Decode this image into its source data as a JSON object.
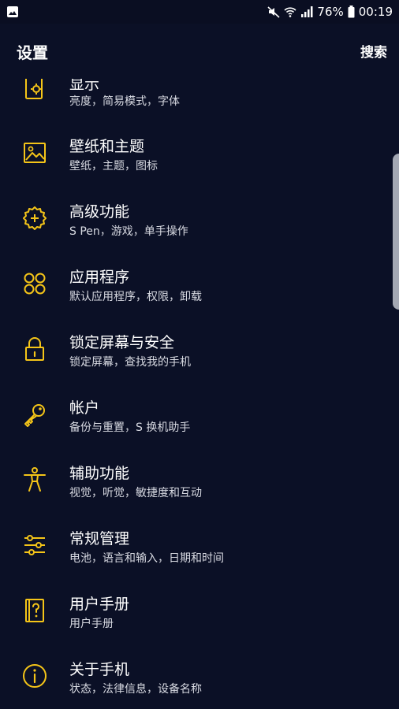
{
  "status_bar": {
    "battery": "76%",
    "time": "00:19"
  },
  "header": {
    "title": "设置",
    "search_label": "搜索"
  },
  "items": [
    {
      "title": "显示",
      "subtitle": "亮度，简易模式，字体",
      "icon": "display-icon"
    },
    {
      "title": "壁纸和主题",
      "subtitle": "壁纸，主题，图标",
      "icon": "wallpaper-icon"
    },
    {
      "title": "高级功能",
      "subtitle": "S Pen，游戏，单手操作",
      "icon": "advanced-gear-icon"
    },
    {
      "title": "应用程序",
      "subtitle": "默认应用程序，权限，卸载",
      "icon": "apps-icon"
    },
    {
      "title": "锁定屏幕与安全",
      "subtitle": "锁定屏幕，查找我的手机",
      "icon": "lock-icon"
    },
    {
      "title": "帐户",
      "subtitle": "备份与重置，S 换机助手",
      "icon": "key-icon"
    },
    {
      "title": "辅助功能",
      "subtitle": "视觉，听觉，敏捷度和互动",
      "icon": "accessibility-icon"
    },
    {
      "title": "常规管理",
      "subtitle": "电池，语言和输入，日期和时间",
      "icon": "sliders-icon"
    },
    {
      "title": "用户手册",
      "subtitle": "用户手册",
      "icon": "manual-icon"
    },
    {
      "title": "关于手机",
      "subtitle": "状态，法律信息，设备名称",
      "icon": "info-icon"
    }
  ],
  "colors": {
    "background": "#0b1026",
    "icon_accent": "#f5c518",
    "text_primary": "#ffffff",
    "text_secondary": "#d8dae2"
  }
}
